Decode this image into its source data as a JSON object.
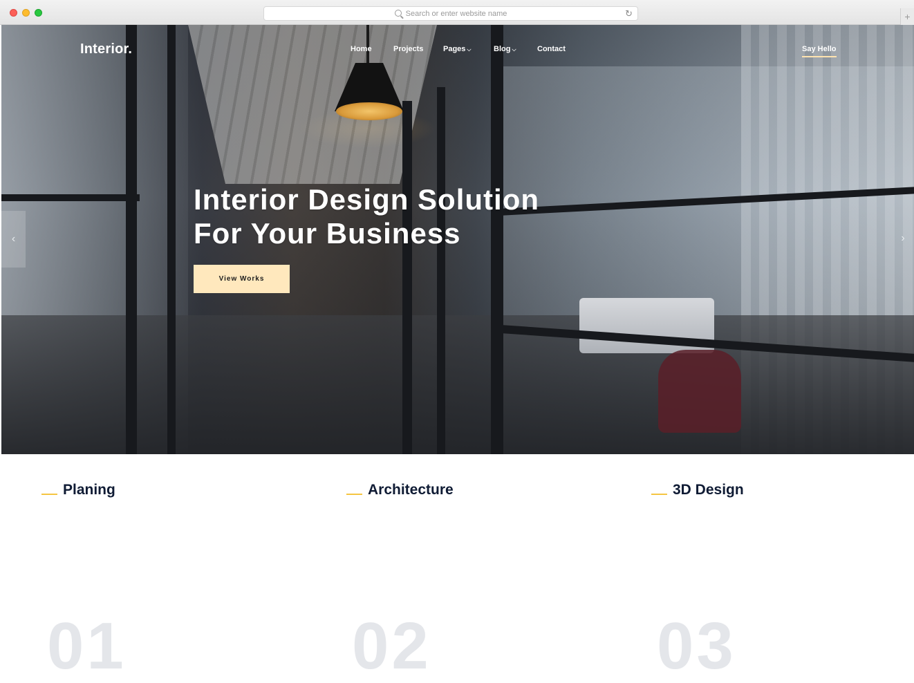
{
  "browser": {
    "url_placeholder": "Search or enter website name",
    "search_icon": "search-icon",
    "reload_icon": "reload-icon",
    "new_tab_label": "+"
  },
  "site": {
    "logo": "Interior.",
    "nav": [
      {
        "label": "Home"
      },
      {
        "label": "Projects"
      },
      {
        "label": "Pages",
        "has_dropdown": true
      },
      {
        "label": "Blog",
        "has_dropdown": true
      },
      {
        "label": "Contact"
      }
    ],
    "cta_nav": "Say Hello"
  },
  "hero": {
    "title_line1": "Interior Design Solution",
    "title_line2": "For Your Business",
    "button_label": "View Works",
    "prev_arrow": "‹",
    "next_arrow": "›"
  },
  "services": [
    {
      "title": "Planing",
      "number": "01"
    },
    {
      "title": "Architecture",
      "number": "02"
    },
    {
      "title": "3D Design",
      "number": "03"
    }
  ],
  "colors": {
    "accent": "#f5c542",
    "button_bg": "#ffe8bd",
    "heading_dark": "#0f1b34"
  }
}
